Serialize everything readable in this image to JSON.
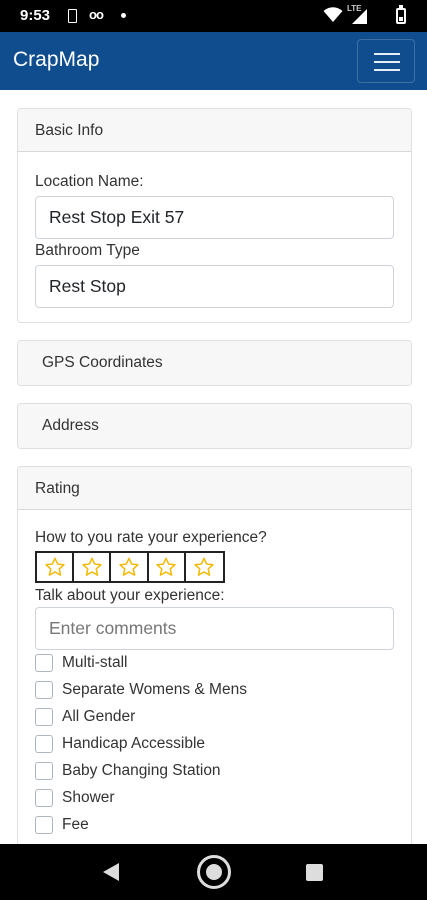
{
  "status_bar": {
    "time": "9:53",
    "network": "LTE",
    "voicemail_glyph": "oo"
  },
  "app": {
    "brand": "CrapMap",
    "accent": "#0f4d8e"
  },
  "basic_info": {
    "header": "Basic Info",
    "location_name_label": "Location Name:",
    "location_name_value": "Rest Stop Exit 57",
    "bathroom_type_label": "Bathroom Type",
    "bathroom_type_value": "Rest Stop"
  },
  "gps": {
    "header": "GPS Coordinates"
  },
  "address": {
    "header": "Address"
  },
  "rating": {
    "header": "Rating",
    "question": "How to you rate your experience?",
    "star_count": 5,
    "star_color": "#f5b800",
    "selected_stars": 0,
    "comments_label": "Talk about your experience:",
    "comments_placeholder": "Enter comments",
    "options": [
      {
        "label": "Multi-stall",
        "checked": false
      },
      {
        "label": "Separate Womens & Mens",
        "checked": false
      },
      {
        "label": "All Gender",
        "checked": false
      },
      {
        "label": "Handicap Accessible",
        "checked": false
      },
      {
        "label": "Baby Changing Station",
        "checked": false
      },
      {
        "label": "Shower",
        "checked": false
      },
      {
        "label": "Fee",
        "checked": false
      }
    ]
  }
}
